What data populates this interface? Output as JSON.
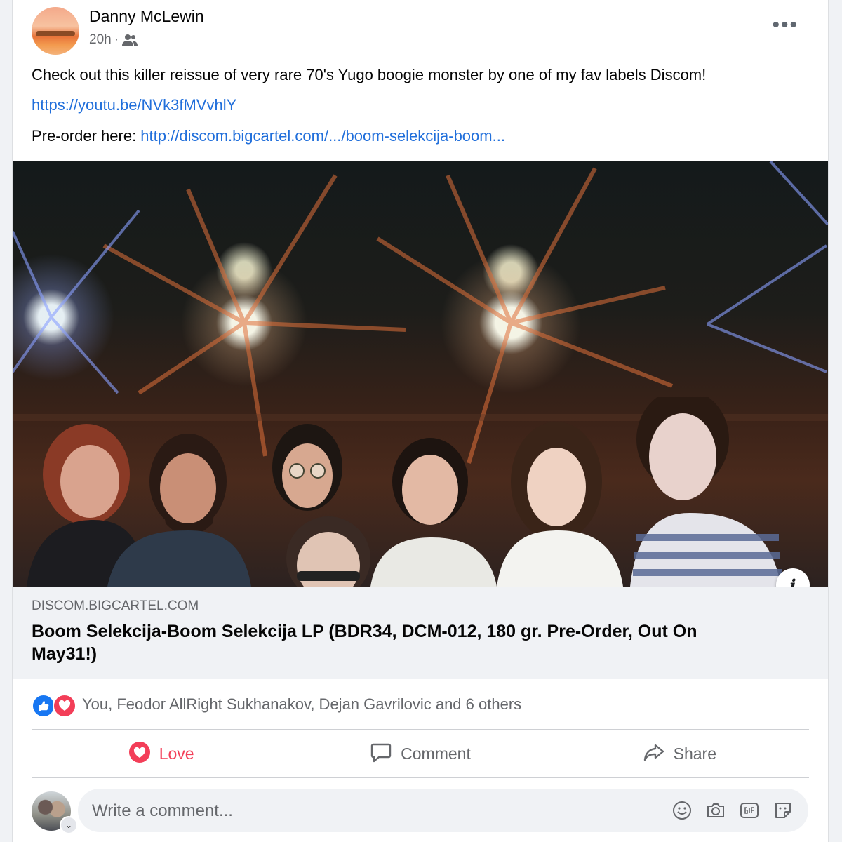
{
  "post": {
    "author": "Danny McLewin",
    "time": "20h",
    "meta_separator": "·",
    "more_label": "•••",
    "body_line": "Check out this killer reissue of very rare 70's Yugo boogie monster by one of my fav labels Discom!",
    "youtube_link": "https://youtu.be/NVk3fMVvhlY",
    "preorder_prefix": "Pre-order here: ",
    "preorder_link": "http://discom.bigcartel.com/.../boom-selekcija-boom..."
  },
  "link_preview": {
    "info_label": "i",
    "domain": "DISCOM.BIGCARTEL.COM",
    "title": "Boom Selekcija-Boom Selekcija LP (BDR34, DCM-012, 180 gr. Pre-Order, Out On May31!)"
  },
  "reactions": {
    "text": "You, Feodor AllRight Sukhanakov, Dejan Gavrilovic and 6 others",
    "icons": [
      "like-icon",
      "love-icon"
    ],
    "colors": {
      "like": "#1877f2",
      "love": "#f33e58"
    }
  },
  "actions": {
    "love": "Love",
    "comment": "Comment",
    "share": "Share"
  },
  "comment": {
    "placeholder": "Write a comment...",
    "caret": "⌄",
    "icons": [
      "emoji-icon",
      "camera-icon",
      "gif-icon",
      "sticker-icon"
    ]
  },
  "colors": {
    "link": "#216fdb",
    "secondary_text": "#65676b",
    "primary_text": "#050505",
    "background": "#f0f2f5"
  }
}
